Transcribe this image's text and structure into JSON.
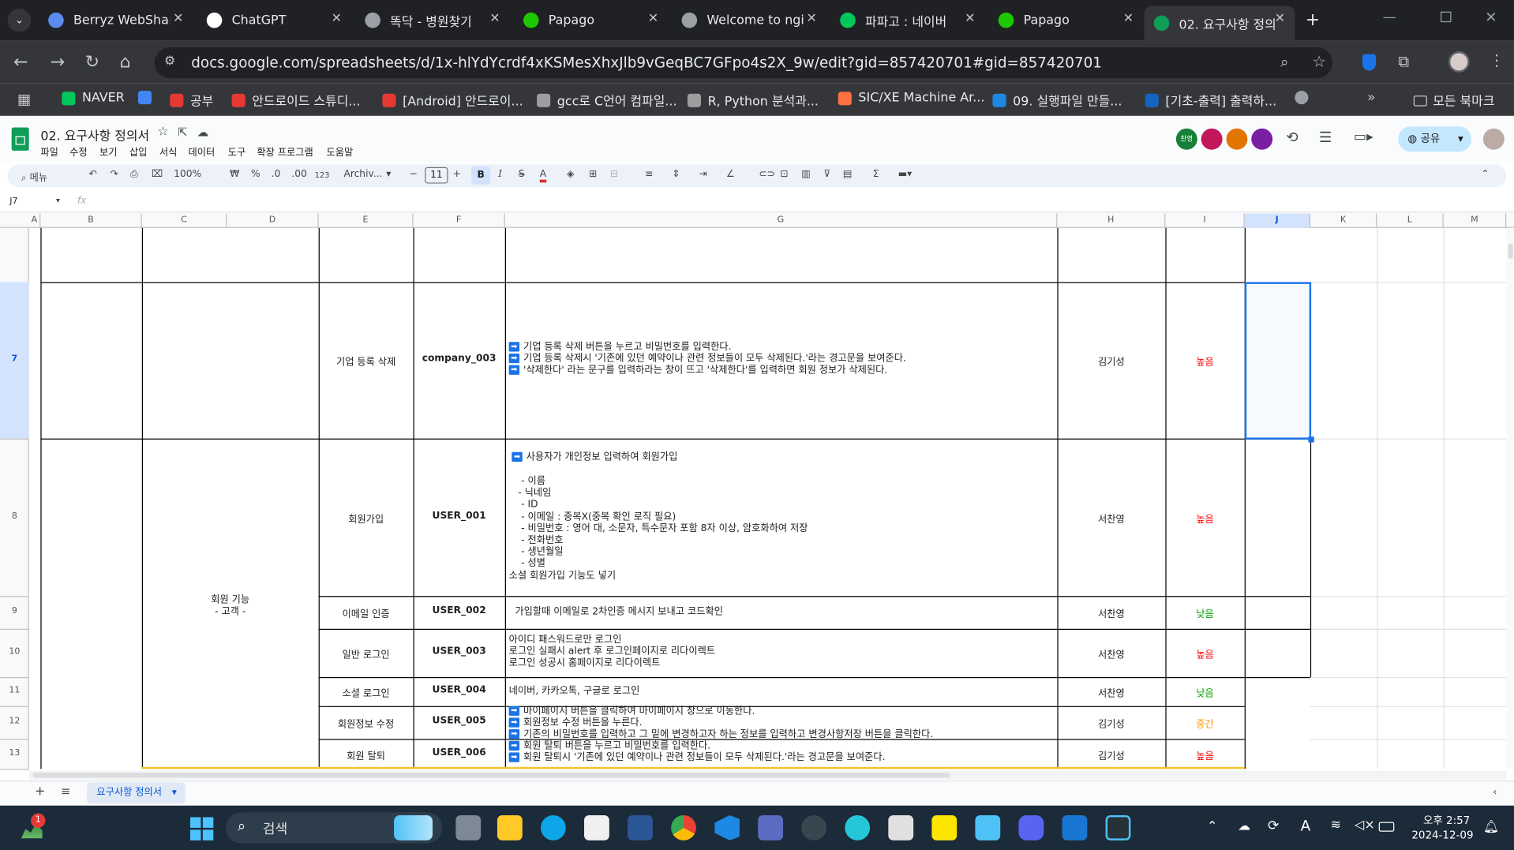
{
  "tabs": [
    {
      "title": "Berryz WebShar",
      "color": "#5b8def"
    },
    {
      "title": "ChatGPT",
      "color": "#ffffff"
    },
    {
      "title": "똑닥 - 병원찾기",
      "color": "#9aa0a6"
    },
    {
      "title": "Papago",
      "color": "#1ec800"
    },
    {
      "title": "Welcome to ngi",
      "color": "#9aa0a6"
    },
    {
      "title": "파파고 : 네이버",
      "color": "#03c75a"
    },
    {
      "title": "Papago",
      "color": "#1ec800"
    },
    {
      "title": "02. 요구사항 정의",
      "color": "#0f9d58"
    }
  ],
  "url": "docs.google.com/spreadsheets/d/1x-hlYdYcrdf4xKSMesXhxJlb9vGeqBC7GFpo4s2X_9w/edit?gid=857420701#gid=857420701",
  "bookmarks": [
    {
      "label": "NAVER",
      "color": "#03c75a"
    },
    {
      "label": "",
      "color": "#4285f4"
    },
    {
      "label": "공부",
      "color": "#e53935"
    },
    {
      "label": "안드로이드 스튜디...",
      "color": "#e53935"
    },
    {
      "label": "[Android] 안드로이...",
      "color": "#e53935"
    },
    {
      "label": "gcc로 C언어 컴파일...",
      "color": "#9e9e9e"
    },
    {
      "label": "R, Python 분석과...",
      "color": "#9e9e9e"
    },
    {
      "label": "SIC/XE Machine Ar...",
      "color": "#ff7043"
    },
    {
      "label": "09. 실행파일 만들...",
      "color": "#1e88e5"
    },
    {
      "label": "[기초-출력] 출력하...",
      "color": "#1565c0"
    }
  ],
  "all_bookmarks": "모든 북마크",
  "doc_title": "02. 요구사항 정의서",
  "menu": [
    "파일",
    "수정",
    "보기",
    "삽입",
    "서식",
    "데이터",
    "도구",
    "확장 프로그램",
    "도움말"
  ],
  "share_label": "공유",
  "toolbar": {
    "search": "메뉴",
    "zoom": "100%",
    "font": "Archiv...",
    "font_size": "11",
    "currency": "₩",
    "percent": "%",
    "dec_less": ".0",
    "dec_more": ".00",
    "format": "123"
  },
  "cell_ref": "J7",
  "fx": "fx",
  "columns": [
    "A",
    "B",
    "C",
    "D",
    "E",
    "F",
    "G",
    "H",
    "I",
    "J",
    "K",
    "L",
    "M"
  ],
  "rows": [
    {
      "num": "7",
      "feature": "기업 등록 삭제",
      "id": "company_003",
      "desc": [
        "기업 등록 삭제 버튼을 누르고 비밀번호를 입력한다.",
        "기업 등록 삭제시 '기존에 있던 예약이나 관련 정보들이 모두 삭제된다.'라는 경고문을 보여준다.",
        "'삭제한다' 라는 문구를 입력하라는 창이 뜨고 '삭제한다'를 입력하면 회원 정보가 삭제된다."
      ],
      "owner": "김기성",
      "priority": "높음"
    },
    {
      "num": "8",
      "feature": "회원가입",
      "id": "USER_001",
      "desc_head": "사용자가 개인정보 입력하여 회원가입",
      "desc_lines": [
        "    - 이름",
        "   - 닉네임",
        "    - ID",
        "    - 이메일 : 중복X(중복 확인 로직 필요)",
        "    - 비밀번호 : 영어 대, 소문자, 특수문자 포함 8자 이상, 암호화하여 저장",
        "    - 전화번호",
        "    - 생년월일",
        "    - 성별",
        "소셜 회원가입 기능도 넣기"
      ],
      "owner": "서찬영",
      "priority": "높음"
    },
    {
      "num": "9",
      "feature": "이메일 인증",
      "id": "USER_002",
      "desc": [
        "  가입할때 이메일로 2차인증 메시지 보내고 코드확인"
      ],
      "owner": "서찬영",
      "priority": "낮음"
    },
    {
      "num": "10",
      "feature": "일반 로그인",
      "id": "USER_003",
      "desc": [
        "아이디 패스워드로만 로그인",
        "로그인 실패시 alert 후 로그인페이지로 리다이렉트",
        "로그인 성공시 홈페이지로 리다이렉트"
      ],
      "owner": "서찬영",
      "priority": "높음"
    },
    {
      "num": "11",
      "feature": "소셜 로그인",
      "id": "USER_004",
      "desc": [
        "네이버, 카카오톡, 구글로 로그인"
      ],
      "owner": "서찬영",
      "priority": "낮음"
    },
    {
      "num": "12",
      "feature": "회원정보 수정",
      "id": "USER_005",
      "desc": [
        "마이페이지 버튼을 클릭하여 마이페이지 창으로 이동한다.",
        "회원정보 수정 버튼을 누른다.",
        "기존의 비밀번호를 입력하고 그 밑에 변경하고자 하는 정보를 입력하고 변경사항저장 버튼을 클릭한다."
      ],
      "owner": "김기성",
      "priority": "중간"
    },
    {
      "num": "13",
      "feature": "회원 탈퇴",
      "id": "USER_006",
      "desc": [
        "회원 탈퇴 버튼을 누르고 비밀번호를 입력한다.",
        "회원 탈퇴시 '기존에 있던 예약이나 관련 정보들이 모두 삭제된다.'라는 경고문을 보여준다."
      ],
      "owner": "김기성",
      "priority": "높음"
    }
  ],
  "group_label_line1": "회원 기능",
  "group_label_line2": "- 고객 -",
  "sheet_tab": "요구사항 정의서",
  "taskbar": {
    "search": "검색",
    "time": "오후 2:57",
    "date": "2024-12-09",
    "badge": "1"
  }
}
